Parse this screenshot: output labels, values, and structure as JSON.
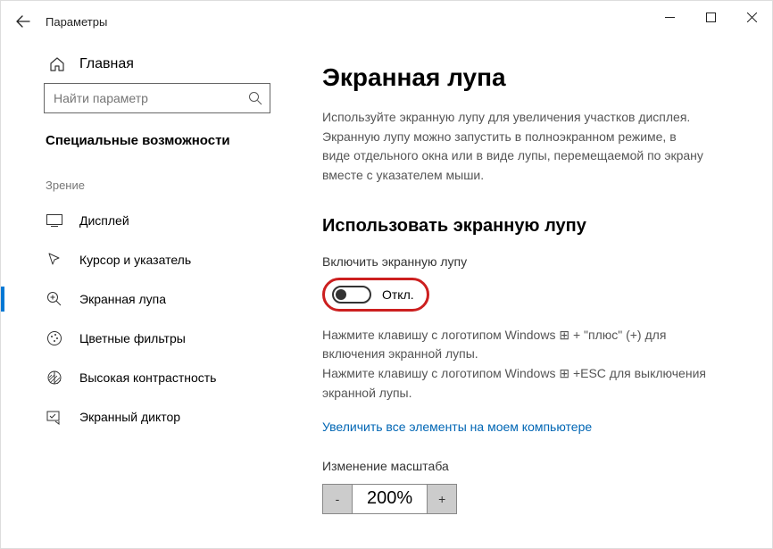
{
  "window": {
    "title": "Параметры"
  },
  "sidebar": {
    "home": "Главная",
    "search_placeholder": "Найти параметр",
    "category": "Специальные возможности",
    "group": "Зрение",
    "items": [
      {
        "label": "Дисплей"
      },
      {
        "label": "Курсор и указатель"
      },
      {
        "label": "Экранная лупа"
      },
      {
        "label": "Цветные фильтры"
      },
      {
        "label": "Высокая контрастность"
      },
      {
        "label": "Экранный диктор"
      }
    ]
  },
  "main": {
    "title": "Экранная лупа",
    "description": "Используйте экранную лупу для увеличения участков дисплея. Экранную лупу можно запустить в полноэкранном режиме, в виде отдельного окна или в виде лупы, перемещаемой по экрану вместе с указателем мыши.",
    "use_heading": "Использовать экранную лупу",
    "enable_label": "Включить экранную лупу",
    "toggle_state": "Откл.",
    "hint1": "Нажмите клавишу с логотипом Windows ⊞ + \"плюс\" (+) для включения экранной лупы.",
    "hint2": "Нажмите клавишу с логотипом Windows ⊞ +ESC для выключения экранной лупы.",
    "link": "Увеличить все элементы на моем компьютере",
    "zoom_label": "Изменение масштаба",
    "zoom_minus": "-",
    "zoom_value": "200%",
    "zoom_plus": "+"
  }
}
